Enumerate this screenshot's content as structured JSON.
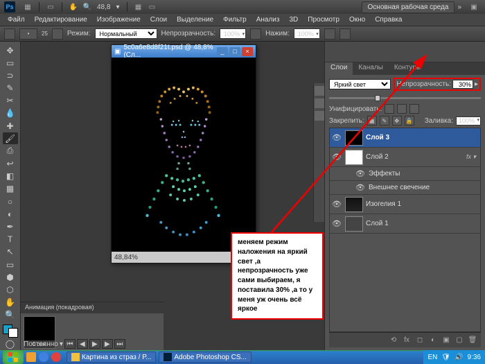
{
  "titlebar": {
    "zoom_value": "48,8",
    "workspace_button": "Основная рабочая среда"
  },
  "menu": {
    "items": [
      "Файл",
      "Редактирование",
      "Изображение",
      "Слои",
      "Выделение",
      "Фильтр",
      "Анализ",
      "3D",
      "Просмотр",
      "Окно",
      "Справка"
    ]
  },
  "options": {
    "brush_size": "25",
    "mode_label": "Режим:",
    "mode_value": "Нормальный",
    "opacity_label": "Непрозрачность:",
    "opacity_value": "100%",
    "flow_label": "Нажим:",
    "flow_value": "100%"
  },
  "document": {
    "title": "5c0a6e8d8f21t.psd @ 48,8% (Сл...",
    "status_zoom": "48,84%"
  },
  "layers_panel": {
    "tabs": [
      "Слои",
      "Каналы",
      "Контуры"
    ],
    "active_tab": 0,
    "blend_mode": "Яркий свет",
    "opacity_label": "Непрозрачность:",
    "opacity_value": "30%",
    "unify_label": "Унифицировать:",
    "lock_label": "Закрепить:",
    "fill_label": "Заливка:",
    "fill_value": "100%",
    "layers": [
      {
        "name": "Слой 3",
        "selected": true,
        "visible": true
      },
      {
        "name": "Слой 2",
        "selected": false,
        "visible": true,
        "fx": true
      },
      {
        "name": "Эффекты",
        "sub": true,
        "visible": true
      },
      {
        "name": "Внешнее свечение",
        "sub": true,
        "visible": true
      },
      {
        "name": "Изогелия 1",
        "selected": false,
        "visible": true
      },
      {
        "name": "Слой 1",
        "selected": false,
        "visible": true
      }
    ]
  },
  "animation": {
    "title": "Анимация (покадровая)",
    "frame_time": "0 сек.",
    "loop": "Постоянно"
  },
  "annotation": {
    "text": "меняем режим наложения на яркий свет ,а непрозрачность уже сами выбираем, я поставила 30% ,а то у меня уж очень всё яркое"
  },
  "taskbar": {
    "items": [
      "Картина из страз / Р...",
      "Adobe Photoshop CS..."
    ],
    "lang": "EN",
    "time": "9:36"
  }
}
